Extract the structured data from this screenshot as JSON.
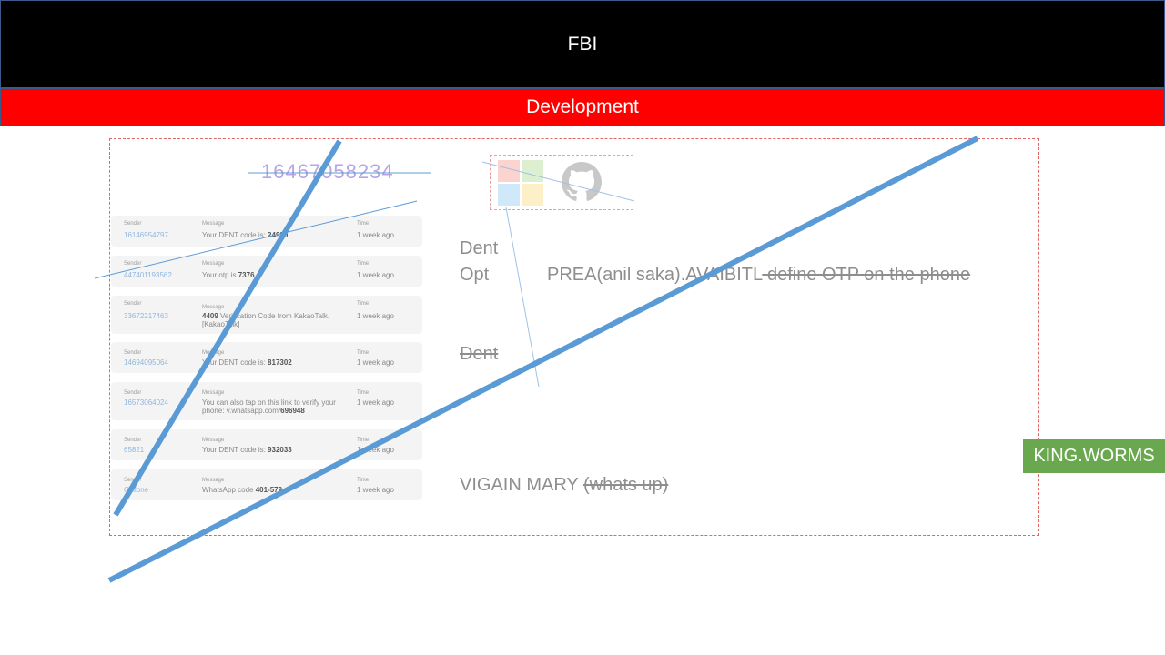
{
  "header": {
    "title": "FBI",
    "subtitle": "Development"
  },
  "phone_number": "16467058234",
  "messages": {
    "sender_label": "Sender",
    "message_label": "Message",
    "time_label": "Time",
    "rows": [
      {
        "sender": "16146954797",
        "text_pre": "Your DENT code is: ",
        "code": "24980",
        "text_post": "",
        "time": "1 week ago"
      },
      {
        "sender": "447401193562",
        "text_pre": "Your otp is ",
        "code": "7376",
        "text_post": "",
        "time": "1 week ago"
      },
      {
        "sender": "33672217463",
        "text_pre": "",
        "code": "4409",
        "text_post": " Verification Code from KakaoTalk. [KakaoTalk]",
        "time": "1 week ago"
      },
      {
        "sender": "14694095064",
        "text_pre": "Your DENT code is: ",
        "code": "817302",
        "text_post": "",
        "time": "1 week ago"
      },
      {
        "sender": "16573064024",
        "text_pre": "You can also tap on this link to verify your phone: v.whatsapp.com/",
        "code": "696948",
        "text_post": "",
        "time": "1 week ago"
      },
      {
        "sender": "65821",
        "text_pre": "Your DENT code is: ",
        "code": "932033",
        "text_post": "",
        "time": "1 week ago"
      },
      {
        "sender": "Cellone",
        "text_pre": "WhatsApp code ",
        "code": "401-572",
        "text_post": "",
        "time": "1 week ago"
      }
    ]
  },
  "side": {
    "dent": "Dent",
    "opt": "Opt",
    "prea": "PREA(anil saka).AVAIBITL",
    "prea_strike": " define OTP on the phone",
    "dent_strike": "Dent",
    "vigain": "VIGAIN MARY ",
    "vigain_strike": "(whats up)"
  },
  "badge": "KING.WORMS",
  "colors": {
    "header_bg": "#000000",
    "banner_bg": "#ff0000",
    "badge_bg": "#6aa84f",
    "line": "#5b9bd5",
    "phone_text": "#b7a3e6"
  },
  "icons": [
    "microsoft-logo-icon",
    "github-logo-icon"
  ]
}
